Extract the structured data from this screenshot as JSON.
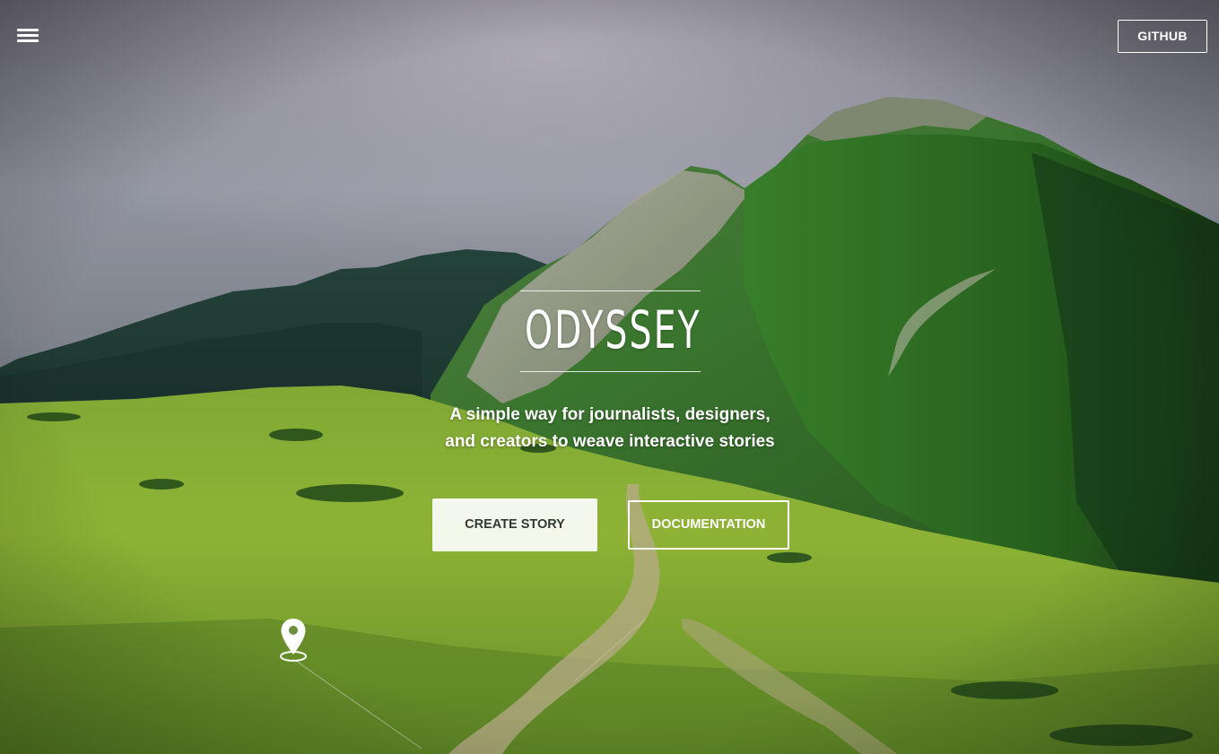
{
  "header": {
    "menu_icon": "hamburger-menu-icon",
    "github_label": "GITHUB"
  },
  "hero": {
    "title": "ODYSSEY",
    "subtitle_line1": "A simple way for journalists, designers,",
    "subtitle_line2": "and creators to weave interactive stories",
    "create_label": "CREATE STORY",
    "docs_label": "DOCUMENTATION",
    "pin_icon": "map-pin-icon"
  },
  "colors": {
    "overlay_text": "#ffffff",
    "create_button_bg": "#f4f5f2",
    "create_button_text": "#2f3a33"
  }
}
